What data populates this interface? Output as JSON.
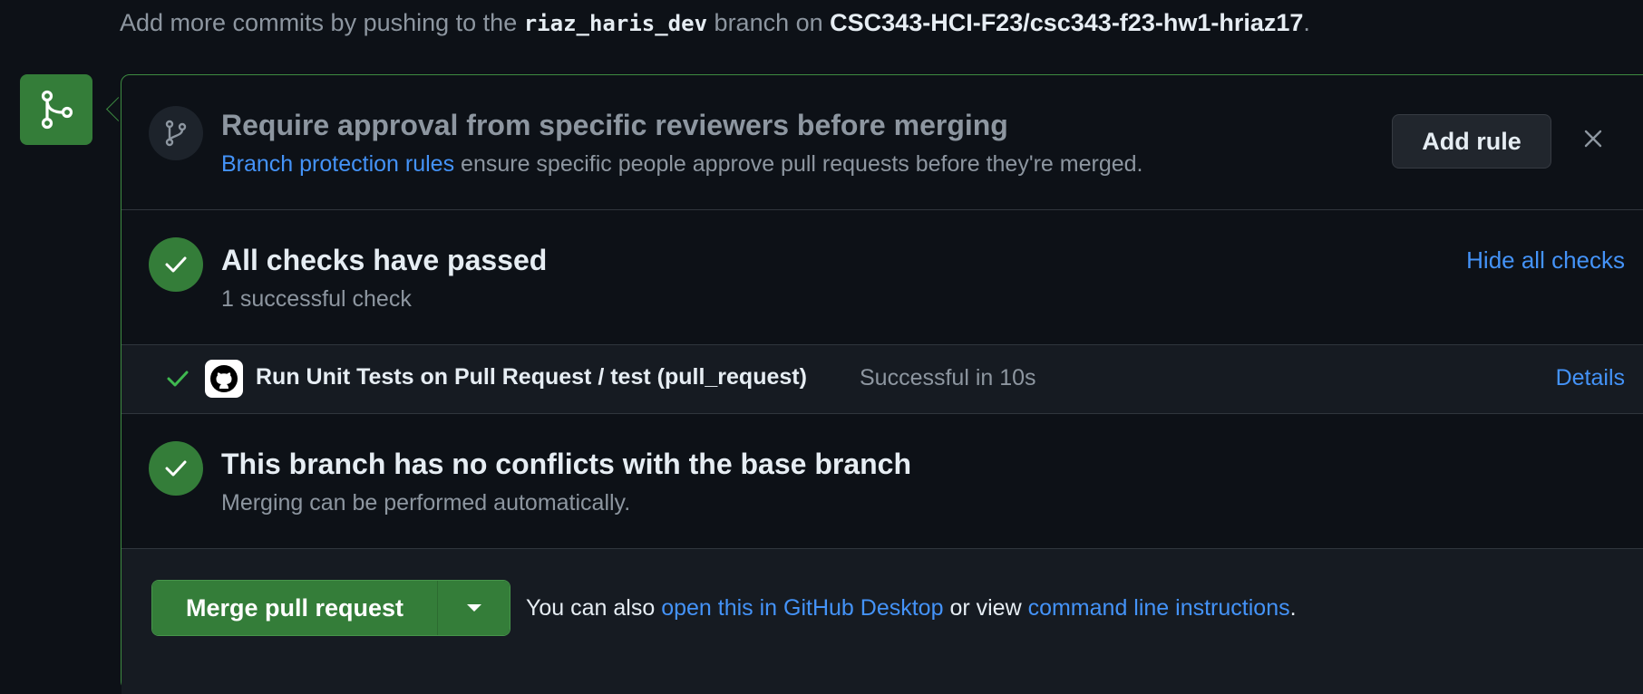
{
  "hint": {
    "prefix": "Add more commits by pushing to the",
    "branch": "riaz_haris_dev",
    "middle": "branch on",
    "repo": "CSC343-HCI-F23/csc343-f23-hw1-hriaz17",
    "suffix": "."
  },
  "approval": {
    "title": "Require approval from specific reviewers before merging",
    "link": "Branch protection rules",
    "text": "ensure specific people approve pull requests before they're merged.",
    "add_rule_label": "Add rule"
  },
  "checks": {
    "title": "All checks have passed",
    "subtitle": "1 successful check",
    "hide_label": "Hide all checks",
    "items": [
      {
        "name": "Run Unit Tests on Pull Request / test (pull_request)",
        "status": "Successful in 10s",
        "details_label": "Details"
      }
    ]
  },
  "conflicts": {
    "title": "This branch has no conflicts with the base branch",
    "subtitle": "Merging can be performed automatically."
  },
  "merge": {
    "button_label": "Merge pull request",
    "note_prefix": "You can also",
    "desktop_link": "open this in GitHub Desktop",
    "note_middle": "or view",
    "cli_link": "command line instructions",
    "note_suffix": "."
  },
  "colors": {
    "background": "#0d1117",
    "success": "#347d39",
    "link": "#4493f8",
    "muted": "#8d96a0"
  }
}
